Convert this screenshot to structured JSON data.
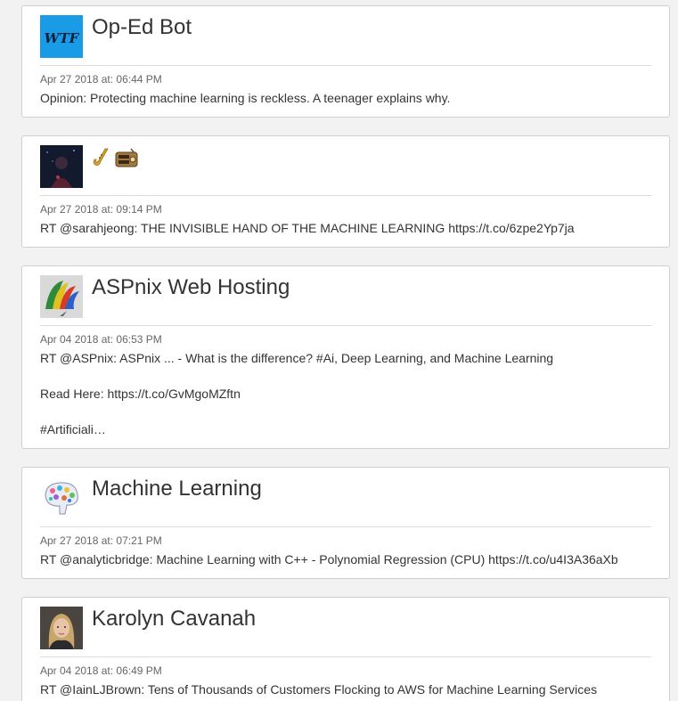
{
  "accent_colors": {
    "wtf_avatar_bg": "#1a9be6",
    "card_border": "#cfcfcf",
    "page_bg": "#f2f2f2"
  },
  "posts": [
    {
      "user_name": "Op-Ed Bot",
      "avatar_text": "WTF",
      "avatar_icon": "wtf-logo-icon",
      "timestamp": "Apr 27 2018 at: 06:44 PM",
      "text": "Opinion: Protecting machine learning is reckless. A teenager explains why."
    },
    {
      "user_name": "",
      "name_icons": [
        "saxophone-icon",
        "radio-icon"
      ],
      "avatar_icon": "night-portrait-avatar",
      "timestamp": "Apr 27 2018 at: 09:14 PM",
      "text": "RT @sarahjeong: THE INVISIBLE HAND OF THE MACHINE LEARNING https://t.co/6zpe2Yp7ja"
    },
    {
      "user_name": "ASPnix Web Hosting",
      "avatar_icon": "rainbow-sail-logo-icon",
      "timestamp": "Apr 04 2018 at: 06:53 PM",
      "text": "RT @ASPnix: ASPnix ... - What is the difference? #Ai, Deep Learning, and Machine Learning\n\nRead Here: https://t.co/GvMgoMZftn\n\n#Artificiali…"
    },
    {
      "user_name": "Machine Learning",
      "avatar_icon": "brain-icon",
      "timestamp": "Apr 27 2018 at: 07:21 PM",
      "text": "RT @analyticbridge: Machine Learning with C++ - Polynomial Regression (CPU) https://t.co/u4I3A36aXb"
    },
    {
      "user_name": "Karolyn Cavanah",
      "avatar_icon": "woman-portrait-avatar",
      "timestamp": "Apr 04 2018 at: 06:49 PM",
      "text": "RT @IainLJBrown: Tens of Thousands of Customers Flocking to AWS for Machine Learning Services\n#DataScience #MachineLearning #DeepLearning #…"
    }
  ]
}
